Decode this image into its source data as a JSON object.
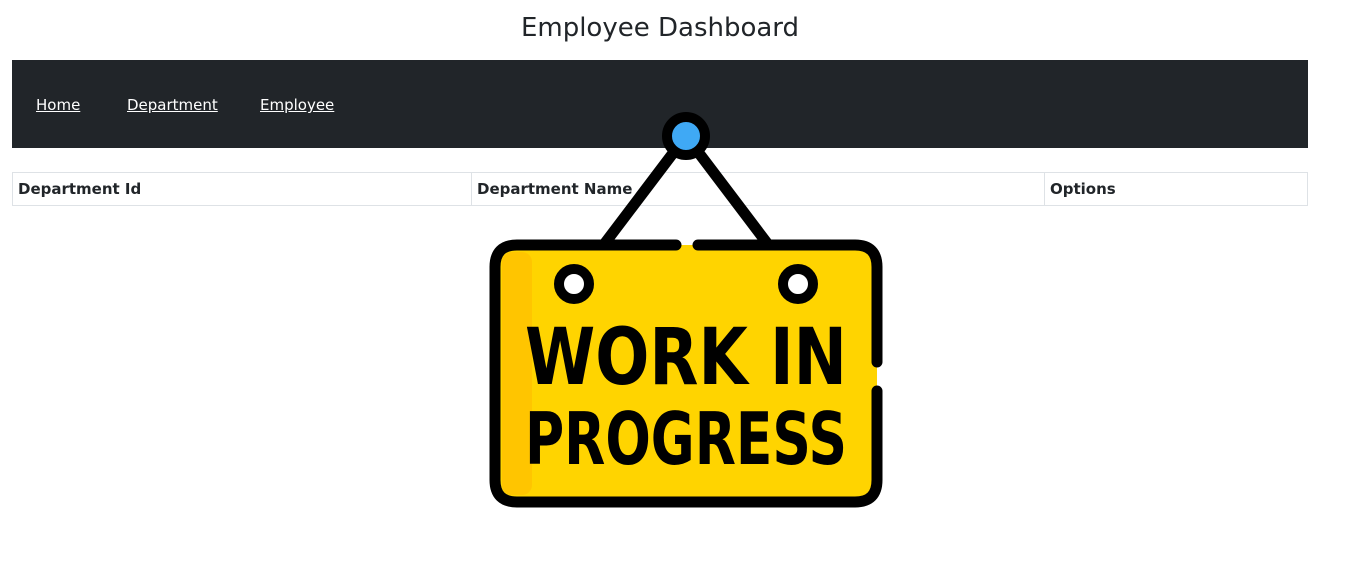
{
  "header": {
    "title": "Employee Dashboard"
  },
  "nav": {
    "items": [
      {
        "label": "Home"
      },
      {
        "label": "Department"
      },
      {
        "label": "Employee"
      }
    ]
  },
  "table": {
    "columns": [
      "Department Id",
      "Department Name",
      "Options"
    ],
    "rows": []
  },
  "overlay": {
    "line1": "WORK IN",
    "line2": "PROGRESS",
    "sign_color": "#FFD400",
    "outline_color": "#000000",
    "pin_color": "#3FA9F5"
  }
}
